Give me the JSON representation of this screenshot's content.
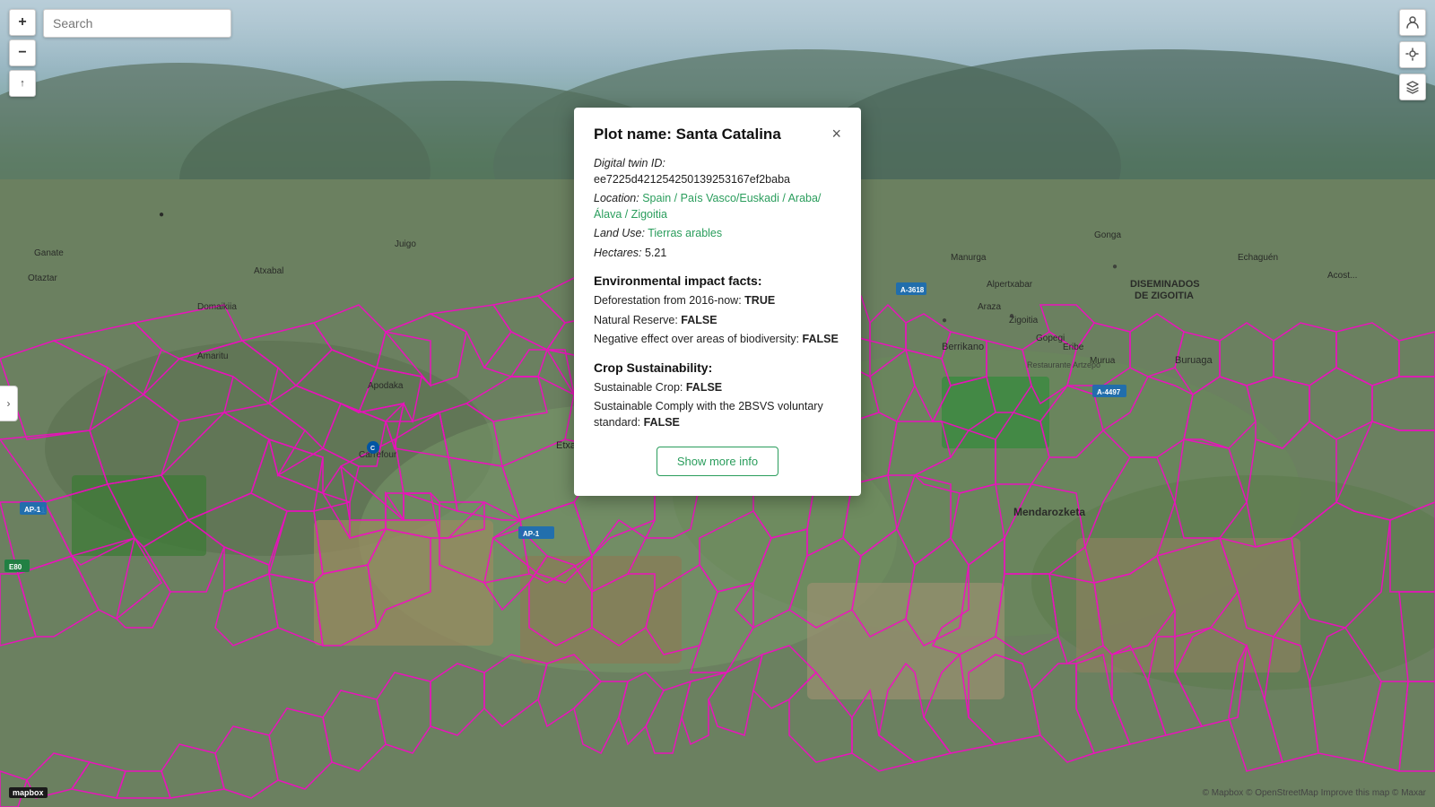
{
  "map": {
    "search_placeholder": "Search",
    "zoom_in_label": "+",
    "zoom_out_label": "−",
    "compass_label": "↑",
    "collapse_arrow": "›",
    "attribution": "© Mapbox © OpenStreetMap Improve this map © Maxar",
    "mapbox_label": "mapbox"
  },
  "popup": {
    "title": "Plot name: Santa Catalina",
    "close_label": "×",
    "digital_twin_label": "Digital twin ID:",
    "digital_twin_value": "ee7225d421254250139253167ef2baba",
    "location_label": "Location:",
    "location_value": "Spain / País Vasco/Euskadi / Araba/Álava / Zigoitia",
    "land_use_label": "Land Use:",
    "land_use_value": "Tierras arables",
    "hectares_label": "Hectares:",
    "hectares_value": "5.21",
    "env_section_title": "Environmental impact facts:",
    "deforestation_label": "Deforestation from 2016-now:",
    "deforestation_value": "TRUE",
    "natural_reserve_label": "Natural Reserve:",
    "natural_reserve_value": "FALSE",
    "biodiversity_label": "Negative effect over areas of biodiversity:",
    "biodiversity_value": "FALSE",
    "crop_section_title": "Crop Sustainability:",
    "sustainable_crop_label": "Sustainable Crop:",
    "sustainable_crop_value": "FALSE",
    "bsvs_label": "Sustainable Comply with the 2BSVS voluntary standard:",
    "bsvs_value": "FALSE",
    "show_more_label": "Show more info"
  },
  "icons": {
    "user": "👤",
    "location": "📍",
    "layers": "⊞"
  }
}
